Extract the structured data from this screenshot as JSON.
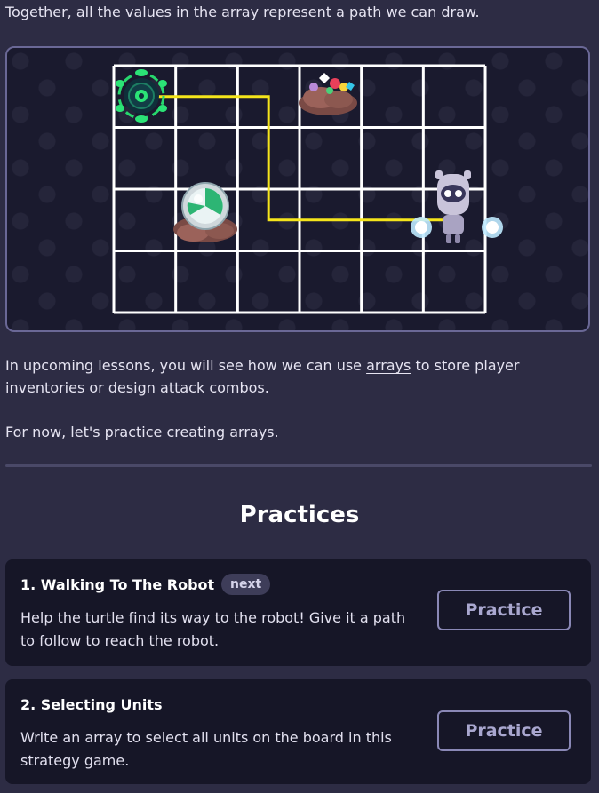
{
  "intro": {
    "before": "Together, all the values in the ",
    "link": "array",
    "after": " represent a path we can draw."
  },
  "board": {
    "columns": 6,
    "rows": 4,
    "path_cells": [
      [
        0,
        0
      ],
      [
        1,
        0
      ],
      [
        2,
        0
      ],
      [
        2,
        1
      ],
      [
        2,
        2
      ],
      [
        3,
        2
      ],
      [
        4,
        2
      ],
      [
        5,
        2
      ]
    ],
    "path_color": "#f5e51b",
    "grid_color": "#ffffff",
    "sprites": [
      {
        "name": "turtle-icon",
        "cell": [
          0,
          0
        ]
      },
      {
        "name": "gem-pile-icon",
        "cell": [
          3,
          0
        ]
      },
      {
        "name": "crystal-ball-icon",
        "cell": [
          1,
          2
        ]
      },
      {
        "name": "robot-icon",
        "cell": [
          5,
          2
        ]
      }
    ]
  },
  "para1": {
    "before": "In upcoming lessons, you will see how we can use ",
    "link": "arrays",
    "after": " to store player inventories or design attack combos."
  },
  "para2": {
    "before": "For now, let's practice creating ",
    "link": "arrays",
    "after": "."
  },
  "practices": {
    "title": "Practices",
    "items": [
      {
        "title": "1. Walking To The Robot",
        "badge": "next",
        "description": "Help the turtle find its way to the robot! Give it a path to follow to reach the robot.",
        "button": "Practice"
      },
      {
        "title": "2. Selecting Units",
        "description": "Write an array to select all units on the board in this strategy game.",
        "button": "Practice"
      }
    ]
  }
}
